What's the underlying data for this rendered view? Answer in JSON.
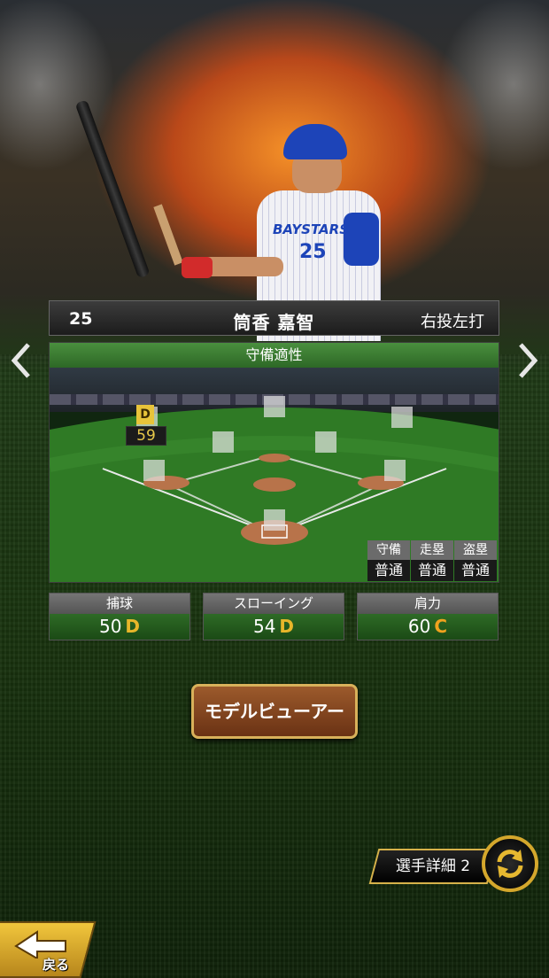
{
  "player": {
    "number": "25",
    "name": "筒香 嘉智",
    "handedness": "右投左打",
    "uniform_logo": "BAYSTARS",
    "uniform_number": "25"
  },
  "navigation": {
    "prev_icon": "chevron-left-icon",
    "next_icon": "chevron-right-icon"
  },
  "fielding": {
    "title": "守備適性",
    "selected_position_grade": "D",
    "selected_position_value": "59",
    "mini_stats": [
      {
        "label": "守備",
        "value": "普通"
      },
      {
        "label": "走塁",
        "value": "普通"
      },
      {
        "label": "盗塁",
        "value": "普通"
      }
    ]
  },
  "abilities": [
    {
      "label": "捕球",
      "value": "50",
      "grade": "D",
      "grade_color": "#e8b62a"
    },
    {
      "label": "スローイング",
      "value": "54",
      "grade": "D",
      "grade_color": "#e8b62a"
    },
    {
      "label": "肩力",
      "value": "60",
      "grade": "C",
      "grade_color": "#f0a21e"
    }
  ],
  "buttons": {
    "model_viewer": "モデルビューアー",
    "player_detail": "選手詳細 2",
    "back": "戻る"
  }
}
